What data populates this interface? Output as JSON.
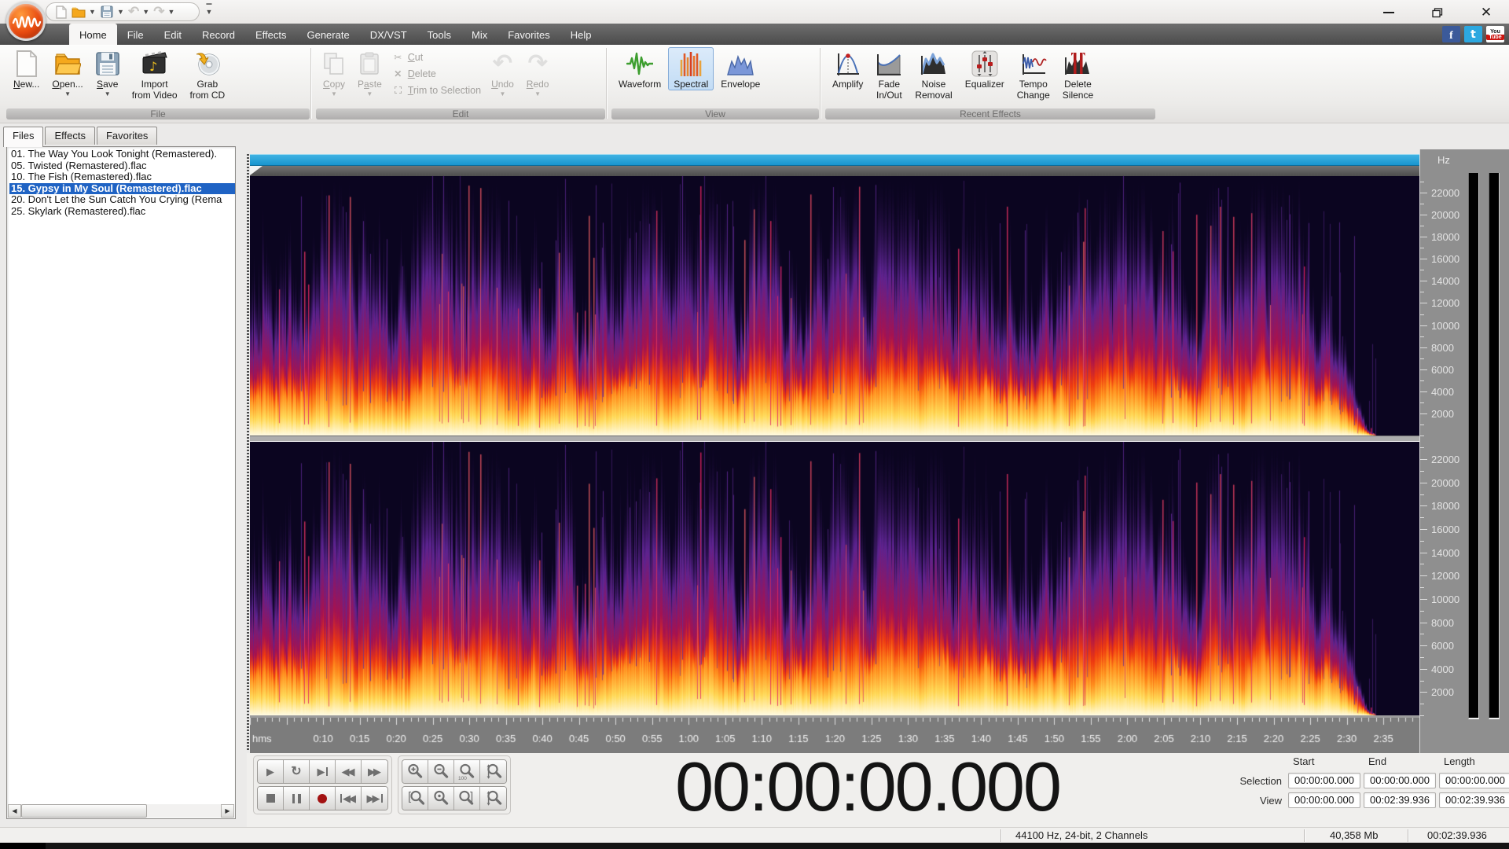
{
  "window": {
    "controls": [
      "minimize",
      "restore",
      "close"
    ]
  },
  "quick_access": {
    "icons": [
      "new-file",
      "open-folder",
      "save",
      "undo",
      "redo"
    ],
    "more": "customize-quick-access"
  },
  "menu": {
    "tabs": [
      "Home",
      "File",
      "Edit",
      "Record",
      "Effects",
      "Generate",
      "DX/VST",
      "Tools",
      "Mix",
      "Favorites",
      "Help"
    ],
    "active": "Home",
    "social": [
      "facebook",
      "twitter",
      "youtube"
    ]
  },
  "ribbon": {
    "groups": [
      {
        "label": "File",
        "buttons": [
          {
            "label": "New...",
            "u": 0,
            "icon": "new-file",
            "arrow": false,
            "enabled": true
          },
          {
            "label": "Open...",
            "u": 0,
            "icon": "open-folder",
            "arrow": true,
            "enabled": true
          },
          {
            "label": "Save",
            "u": 0,
            "icon": "save-disk",
            "arrow": true,
            "enabled": true
          },
          {
            "label": "Import\nfrom Video",
            "icon": "import-video",
            "arrow": false,
            "enabled": true
          },
          {
            "label": "Grab\nfrom CD",
            "icon": "grab-cd",
            "arrow": false,
            "enabled": true
          }
        ]
      },
      {
        "label": "Edit",
        "big1": [
          {
            "label": "Copy",
            "u": 0,
            "icon": "copy",
            "arrow": true,
            "enabled": false
          },
          {
            "label": "Paste",
            "u": 1,
            "icon": "paste",
            "arrow": true,
            "enabled": false
          }
        ],
        "small": [
          {
            "label": "Cut",
            "u": 0,
            "icon": "scissors",
            "enabled": false
          },
          {
            "label": "Delete",
            "u": 0,
            "icon": "x-mark",
            "enabled": false
          },
          {
            "label": "Trim to Selection",
            "u": 0,
            "icon": "trim",
            "enabled": false
          }
        ],
        "big2": [
          {
            "label": "Undo",
            "u": 0,
            "icon": "undo-arrow",
            "arrow": true,
            "enabled": false
          },
          {
            "label": "Redo",
            "u": 0,
            "icon": "redo-arrow",
            "arrow": true,
            "enabled": false
          }
        ]
      },
      {
        "label": "View",
        "buttons": [
          {
            "label": "Waveform",
            "icon": "waveform",
            "arrow": false,
            "enabled": true
          },
          {
            "label": "Spectral",
            "icon": "spectral",
            "arrow": false,
            "enabled": true,
            "selected": true
          },
          {
            "label": "Envelope",
            "icon": "envelope",
            "arrow": false,
            "enabled": true
          }
        ]
      },
      {
        "label": "Recent Effects",
        "buttons": [
          {
            "label": "Amplify",
            "icon": "amplify",
            "arrow": false,
            "enabled": true
          },
          {
            "label": "Fade\nIn/Out",
            "icon": "fade",
            "arrow": false,
            "enabled": true
          },
          {
            "label": "Noise\nRemoval",
            "icon": "noise-removal",
            "arrow": false,
            "enabled": true
          },
          {
            "label": "Equalizer",
            "icon": "equalizer",
            "arrow": false,
            "enabled": true
          },
          {
            "label": "Tempo\nChange",
            "icon": "tempo-change",
            "arrow": false,
            "enabled": true
          },
          {
            "label": "Delete\nSilence",
            "icon": "delete-silence",
            "arrow": false,
            "enabled": true
          }
        ]
      }
    ]
  },
  "sidebar": {
    "tabs": [
      "Files",
      "Effects",
      "Favorites"
    ],
    "active_tab": "Files",
    "files": [
      "01. The Way You Look Tonight (Remastered).",
      "05. Twisted (Remastered).flac",
      "10. The Fish (Remastered).flac",
      "15. Gypsy in My Soul (Remastered).flac",
      "20. Don't Let the Sun Catch You Crying (Rema",
      "25. Skylark (Remastered).flac"
    ],
    "selected_index": 3
  },
  "wave_view": {
    "duration_s": 159.936,
    "ruler_unit": "hms",
    "ruler_labels": [
      "0:10",
      "0:15",
      "0:20",
      "0:25",
      "0:30",
      "0:35",
      "0:40",
      "0:45",
      "0:50",
      "0:55",
      "1:00",
      "1:05",
      "1:10",
      "1:15",
      "1:20",
      "1:25",
      "1:30",
      "1:35",
      "1:40",
      "1:45",
      "1:50",
      "1:55",
      "2:00",
      "2:05",
      "2:10",
      "2:15",
      "2:20",
      "2:25",
      "2:30",
      "2:35"
    ],
    "channels": 2
  },
  "freq_axis": {
    "unit": "Hz",
    "labels": [
      "22000",
      "20000",
      "18000",
      "16000",
      "14000",
      "12000",
      "10000",
      "8000",
      "6000",
      "4000",
      "2000"
    ]
  },
  "transport": {
    "row1": [
      "play",
      "loop",
      "play-to-end",
      "rewind",
      "fast-forward"
    ],
    "row2": [
      "stop",
      "pause",
      "record",
      "go-to-start",
      "go-to-end"
    ]
  },
  "zoom_controls": {
    "row1": [
      "zoom-in",
      "zoom-out",
      "zoom-100",
      "zoom-vertical-in"
    ],
    "row2": [
      "zoom-selection-start",
      "zoom-full",
      "zoom-selection-end",
      "zoom-vertical-out"
    ]
  },
  "time_display": "00:00:00.000",
  "selection_panel": {
    "headers": [
      "Start",
      "End",
      "Length"
    ],
    "rows": [
      {
        "label": "Selection",
        "values": [
          "00:00:00.000",
          "00:00:00.000",
          "00:00:00.000"
        ]
      },
      {
        "label": "View",
        "values": [
          "00:00:00.000",
          "00:02:39.936",
          "00:02:39.936"
        ]
      }
    ]
  },
  "status_bar": {
    "format": "44100 Hz, 24-bit, 2 Channels",
    "file_size": "40,358 Mb",
    "length": "00:02:39.936"
  },
  "colors": {
    "accent_blue_bar": "#1a9fd9",
    "selection_blue": "#1f63c4",
    "spectro_background": "#0b0520",
    "spectro_flame": "#ffd957",
    "spectro_red": "#ef3a10",
    "spectro_purple": "#5c2390",
    "record_red": "#a31212"
  }
}
